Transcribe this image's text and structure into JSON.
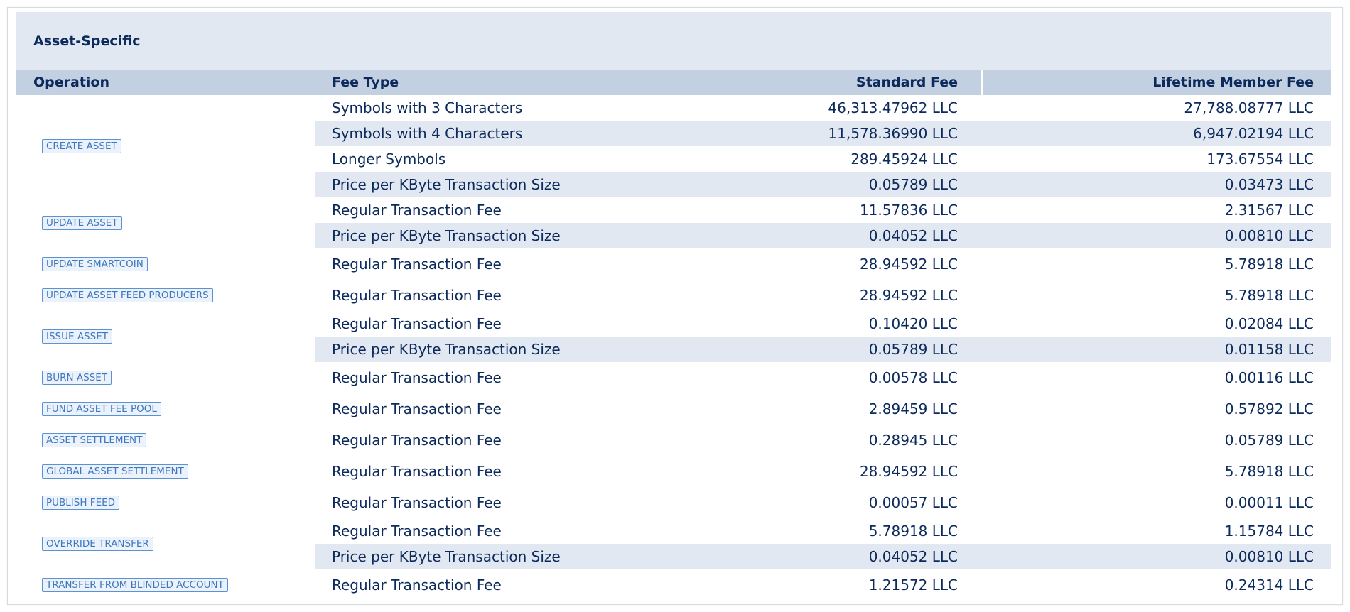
{
  "section": {
    "title": "Asset-Specific"
  },
  "headers": {
    "operation": "Operation",
    "fee_type": "Fee Type",
    "standard_fee": "Standard Fee",
    "lifetime_fee": "Lifetime Member Fee"
  },
  "operations": [
    {
      "name": "CREATE ASSET",
      "fees": [
        {
          "type": "Symbols with 3 Characters",
          "standard": "46,313.47962 LLC",
          "lifetime": "27,788.08777 LLC"
        },
        {
          "type": "Symbols with 4 Characters",
          "standard": "11,578.36990 LLC",
          "lifetime": "6,947.02194 LLC"
        },
        {
          "type": "Longer Symbols",
          "standard": "289.45924 LLC",
          "lifetime": "173.67554 LLC"
        },
        {
          "type": "Price per KByte Transaction Size",
          "standard": "0.05789 LLC",
          "lifetime": "0.03473 LLC"
        }
      ]
    },
    {
      "name": "UPDATE ASSET",
      "fees": [
        {
          "type": "Regular Transaction Fee",
          "standard": "11.57836 LLC",
          "lifetime": "2.31567 LLC"
        },
        {
          "type": "Price per KByte Transaction Size",
          "standard": "0.04052 LLC",
          "lifetime": "0.00810 LLC"
        }
      ]
    },
    {
      "name": "UPDATE SMARTCOIN",
      "fees": [
        {
          "type": "Regular Transaction Fee",
          "standard": "28.94592 LLC",
          "lifetime": "5.78918 LLC"
        }
      ]
    },
    {
      "name": "UPDATE ASSET FEED PRODUCERS",
      "fees": [
        {
          "type": "Regular Transaction Fee",
          "standard": "28.94592 LLC",
          "lifetime": "5.78918 LLC"
        }
      ]
    },
    {
      "name": "ISSUE ASSET",
      "fees": [
        {
          "type": "Regular Transaction Fee",
          "standard": "0.10420 LLC",
          "lifetime": "0.02084 LLC"
        },
        {
          "type": "Price per KByte Transaction Size",
          "standard": "0.05789 LLC",
          "lifetime": "0.01158 LLC"
        }
      ]
    },
    {
      "name": "BURN ASSET",
      "fees": [
        {
          "type": "Regular Transaction Fee",
          "standard": "0.00578 LLC",
          "lifetime": "0.00116 LLC"
        }
      ]
    },
    {
      "name": "FUND ASSET FEE POOL",
      "fees": [
        {
          "type": "Regular Transaction Fee",
          "standard": "2.89459 LLC",
          "lifetime": "0.57892 LLC"
        }
      ]
    },
    {
      "name": "ASSET SETTLEMENT",
      "fees": [
        {
          "type": "Regular Transaction Fee",
          "standard": "0.28945 LLC",
          "lifetime": "0.05789 LLC"
        }
      ]
    },
    {
      "name": "GLOBAL ASSET SETTLEMENT",
      "fees": [
        {
          "type": "Regular Transaction Fee",
          "standard": "28.94592 LLC",
          "lifetime": "5.78918 LLC"
        }
      ]
    },
    {
      "name": "PUBLISH FEED",
      "fees": [
        {
          "type": "Regular Transaction Fee",
          "standard": "0.00057 LLC",
          "lifetime": "0.00011 LLC"
        }
      ]
    },
    {
      "name": "OVERRIDE TRANSFER",
      "fees": [
        {
          "type": "Regular Transaction Fee",
          "standard": "5.78918 LLC",
          "lifetime": "1.15784 LLC"
        },
        {
          "type": "Price per KByte Transaction Size",
          "standard": "0.04052 LLC",
          "lifetime": "0.00810 LLC"
        }
      ]
    },
    {
      "name": "TRANSFER FROM BLINDED ACCOUNT",
      "fees": [
        {
          "type": "Regular Transaction Fee",
          "standard": "1.21572 LLC",
          "lifetime": "0.24314 LLC"
        }
      ]
    }
  ]
}
